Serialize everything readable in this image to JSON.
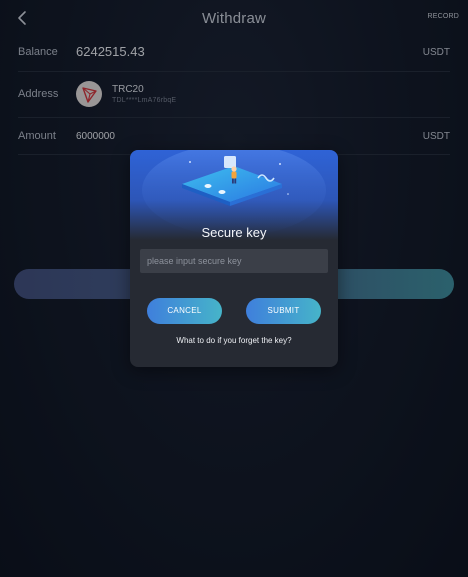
{
  "header": {
    "title": "Withdraw",
    "record_label": "RECORD"
  },
  "balance": {
    "label": "Balance",
    "value": "6242515.43",
    "unit": "USDT"
  },
  "address": {
    "label": "Address",
    "network": "TRC20",
    "value": "TDL****LmA76rbqE",
    "icon": "tron-icon"
  },
  "amount": {
    "label": "Amount",
    "value": "6000000",
    "unit": "USDT"
  },
  "modal": {
    "title": "Secure key",
    "input_placeholder": "please input secure key",
    "input_value": "",
    "cancel_label": "CANCEL",
    "submit_label": "SUBMIT",
    "forget_link": "What to do if you forget the key?"
  },
  "colors": {
    "background": "#131a28",
    "accent_start": "#3f7fdc",
    "accent_end": "#46b4c9",
    "modal_bg": "#262a33",
    "tron_red": "#d8353a"
  }
}
